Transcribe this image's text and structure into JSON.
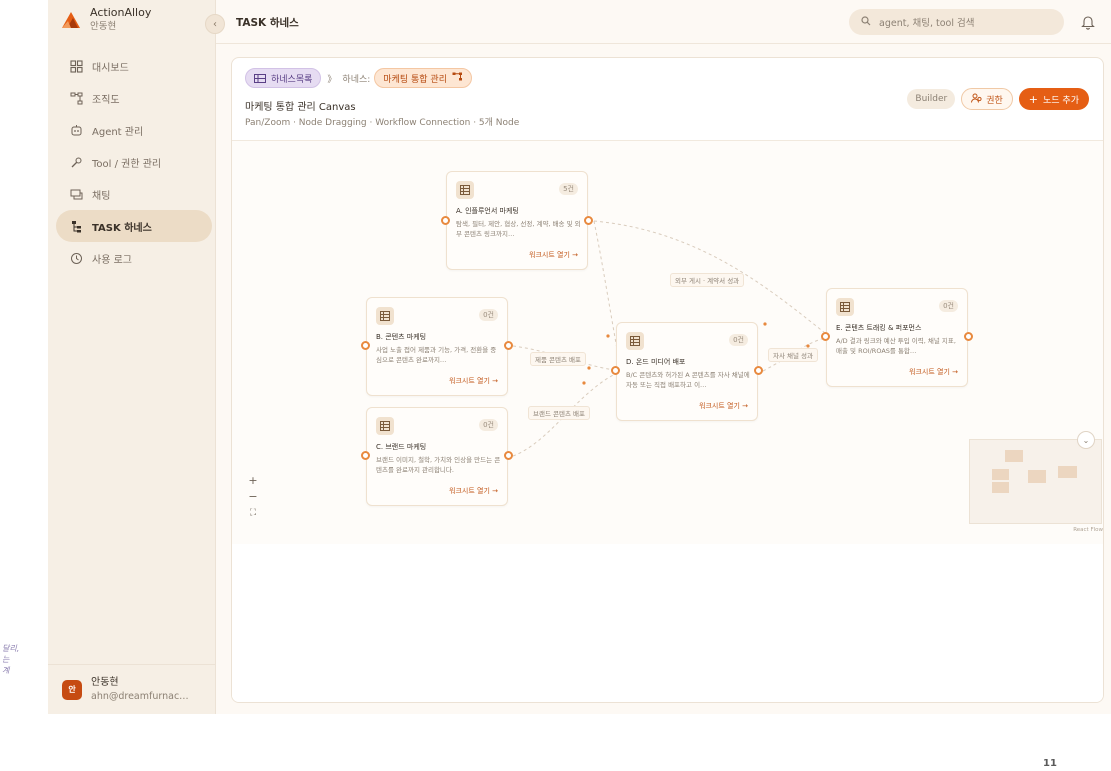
{
  "brand": {
    "name": "ActionAlloy",
    "user": "안동현"
  },
  "sidebar": {
    "items": [
      {
        "label": "대시보드",
        "icon": "dashboard-icon"
      },
      {
        "label": "조직도",
        "icon": "org-chart-icon"
      },
      {
        "label": "Agent 관리",
        "icon": "agent-icon"
      },
      {
        "label": "Tool / 권한 관리",
        "icon": "tool-icon"
      },
      {
        "label": "채팅",
        "icon": "chat-icon"
      },
      {
        "label": "TASK 하네스",
        "icon": "task-icon",
        "active": true
      },
      {
        "label": "사용 로그",
        "icon": "history-icon"
      }
    ],
    "footer": {
      "avatar": "안",
      "name": "안동현",
      "email": "ahn@dreamfurnac…"
    }
  },
  "topbar": {
    "title": "TASK 하네스",
    "search_placeholder": "agent, 채팅, tool 검색"
  },
  "panel": {
    "breadcrumb": {
      "list_label": "하네스목록",
      "separator": "》",
      "prefix": "하네스:",
      "current": "마케팅 통합 관리"
    },
    "title": "마케팅 통합 관리 Canvas",
    "subtitle": "Pan/Zoom · Node Dragging · Workflow Connection · 5개 Node",
    "builder_label": "Builder",
    "permission_label": "권한",
    "add_node_label": "노드 추가"
  },
  "nodes": [
    {
      "id": "A",
      "title": "A. 인플루언서 마케팅",
      "count": "5건",
      "desc": "탐색, 필터, 제안, 협상, 선정, 계약, 배송 및 외부 콘텐츠 링크까지…",
      "link": "워크시트 열기 →"
    },
    {
      "id": "B",
      "title": "B. 콘텐츠 마케팅",
      "count": "0건",
      "desc": "사업 노출 접어 제품과 기능, 가격, 전환을 중심으로 콘텐츠 완료까지…",
      "link": "워크시트 열기 →"
    },
    {
      "id": "C",
      "title": "C. 브랜드 마케팅",
      "count": "0건",
      "desc": "브랜드 이미지, 철학, 가치와 인상을 만드는 콘텐츠를 완료까지 관리합니다.",
      "link": "워크시트 열기 →"
    },
    {
      "id": "D",
      "title": "D. 온드 미디어 배포",
      "count": "0건",
      "desc": "B/C 콘텐츠와 허가된 A 콘텐츠를 자사 채널에 자동 또는 직접 배포하고 이…",
      "link": "워크시트 열기 →"
    },
    {
      "id": "E",
      "title": "E. 콘텐츠 트래킹 & 퍼포먼스",
      "count": "0건",
      "desc": "A/D 결과 링크와 예산 투입 이력, 채널 지표, 매출 및 ROI/ROAS를 통합…",
      "link": "워크시트 열기 →"
    }
  ],
  "edges": [
    {
      "label": "외부 게시 · 계약서 성과"
    },
    {
      "label": "제품 콘텐츠 배포"
    },
    {
      "label": "브랜드 콘텐츠 배포"
    },
    {
      "label": "자사 채널 성과"
    }
  ],
  "zoom_controls": {
    "zoom_in": "+",
    "zoom_out": "−",
    "fit": "⛶"
  },
  "minimap": {
    "attribution": "React Flow"
  },
  "side_note": [
    "달리,",
    "는",
    "계"
  ],
  "page_number": "11",
  "colors": {
    "accent": "#e55e14",
    "sidebar_bg": "#f6efe5",
    "active_bg": "#ecdcc6",
    "handle": "#e8893e"
  }
}
